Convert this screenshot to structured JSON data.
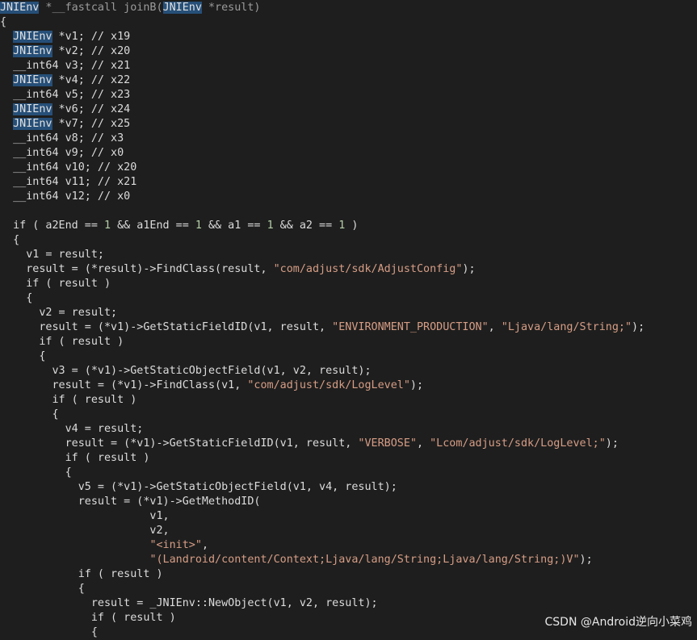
{
  "code_lines": [
    [
      [
        "JNIEnv",
        "hl"
      ],
      [
        " *__fastcall joinB(",
        "dim"
      ],
      [
        "JNIEnv",
        "hl"
      ],
      [
        " *result)",
        "dim"
      ]
    ],
    [
      [
        "{",
        "p"
      ]
    ],
    [
      [
        "  ",
        ""
      ],
      [
        "JNIEnv",
        "hl"
      ],
      [
        " *v1; // x19",
        "var"
      ]
    ],
    [
      [
        "  ",
        ""
      ],
      [
        "JNIEnv",
        "hl"
      ],
      [
        " *v2; // x20",
        "var"
      ]
    ],
    [
      [
        "  __int64 v3; // x21",
        "var"
      ]
    ],
    [
      [
        "  ",
        ""
      ],
      [
        "JNIEnv",
        "hl"
      ],
      [
        " *v4; // x22",
        "var"
      ]
    ],
    [
      [
        "  __int64 v5; // x23",
        "var"
      ]
    ],
    [
      [
        "  ",
        ""
      ],
      [
        "JNIEnv",
        "hl"
      ],
      [
        " *v6; // x24",
        "var"
      ]
    ],
    [
      [
        "  ",
        ""
      ],
      [
        "JNIEnv",
        "hl"
      ],
      [
        " *v7; // x25",
        "var"
      ]
    ],
    [
      [
        "  __int64 v8; // x3",
        "var"
      ]
    ],
    [
      [
        "  __int64 v9; // x0",
        "var"
      ]
    ],
    [
      [
        "  __int64 v10; // x20",
        "var"
      ]
    ],
    [
      [
        "  __int64 v11; // x21",
        "var"
      ]
    ],
    [
      [
        "  __int64 v12; // x0",
        "var"
      ]
    ],
    [],
    [
      [
        "  if ( a2End == ",
        "p"
      ],
      [
        "1",
        "num"
      ],
      [
        " && a1End == ",
        "p"
      ],
      [
        "1",
        "num"
      ],
      [
        " && a1 == ",
        "p"
      ],
      [
        "1",
        "num"
      ],
      [
        " && a2 == ",
        "p"
      ],
      [
        "1",
        "num"
      ],
      [
        " )",
        "p"
      ]
    ],
    [
      [
        "  {",
        "p"
      ]
    ],
    [
      [
        "    v1 = result;",
        "p"
      ]
    ],
    [
      [
        "    result = (*result)->FindClass(result, ",
        "p"
      ],
      [
        "\"com/adjust/sdk/AdjustConfig\"",
        "str"
      ],
      [
        ");",
        "p"
      ]
    ],
    [
      [
        "    if ( result )",
        "p"
      ]
    ],
    [
      [
        "    {",
        "p"
      ]
    ],
    [
      [
        "      v2 = result;",
        "p"
      ]
    ],
    [
      [
        "      result = (*v1)->GetStaticFieldID(v1, result, ",
        "p"
      ],
      [
        "\"ENVIRONMENT_PRODUCTION\"",
        "str"
      ],
      [
        ", ",
        "p"
      ],
      [
        "\"Ljava/lang/String;\"",
        "str"
      ],
      [
        ");",
        "p"
      ]
    ],
    [
      [
        "      if ( result )",
        "p"
      ]
    ],
    [
      [
        "      {",
        "p"
      ]
    ],
    [
      [
        "        v3 = (*v1)->GetStaticObjectField(v1, v2, result);",
        "p"
      ]
    ],
    [
      [
        "        result = (*v1)->FindClass(v1, ",
        "p"
      ],
      [
        "\"com/adjust/sdk/LogLevel\"",
        "str"
      ],
      [
        ");",
        "p"
      ]
    ],
    [
      [
        "        if ( result )",
        "p"
      ]
    ],
    [
      [
        "        {",
        "p"
      ]
    ],
    [
      [
        "          v4 = result;",
        "p"
      ]
    ],
    [
      [
        "          result = (*v1)->GetStaticFieldID(v1, result, ",
        "p"
      ],
      [
        "\"VERBOSE\"",
        "str"
      ],
      [
        ", ",
        "p"
      ],
      [
        "\"Lcom/adjust/sdk/LogLevel;\"",
        "str"
      ],
      [
        ");",
        "p"
      ]
    ],
    [
      [
        "          if ( result )",
        "p"
      ]
    ],
    [
      [
        "          {",
        "p"
      ]
    ],
    [
      [
        "            v5 = (*v1)->GetStaticObjectField(v1, v4, result);",
        "p"
      ]
    ],
    [
      [
        "            result = (*v1)->GetMethodID(",
        "p"
      ]
    ],
    [
      [
        "                       v1,",
        "p"
      ]
    ],
    [
      [
        "                       v2,",
        "p"
      ]
    ],
    [
      [
        "                       ",
        "p"
      ],
      [
        "\"<init>\"",
        "str"
      ],
      [
        ",",
        "p"
      ]
    ],
    [
      [
        "                       ",
        "p"
      ],
      [
        "\"(Landroid/content/Context;Ljava/lang/String;Ljava/lang/String;)V\"",
        "str"
      ],
      [
        ");",
        "p"
      ]
    ],
    [
      [
        "            if ( result )",
        "p"
      ]
    ],
    [
      [
        "            {",
        "p"
      ]
    ],
    [
      [
        "              result = _JNIEnv::NewObject(v1, v2, result);",
        "p"
      ]
    ],
    [
      [
        "              if ( result )",
        "p"
      ]
    ],
    [
      [
        "              {",
        "p"
      ]
    ]
  ],
  "watermark": "CSDN @Android逆向小菜鸡"
}
